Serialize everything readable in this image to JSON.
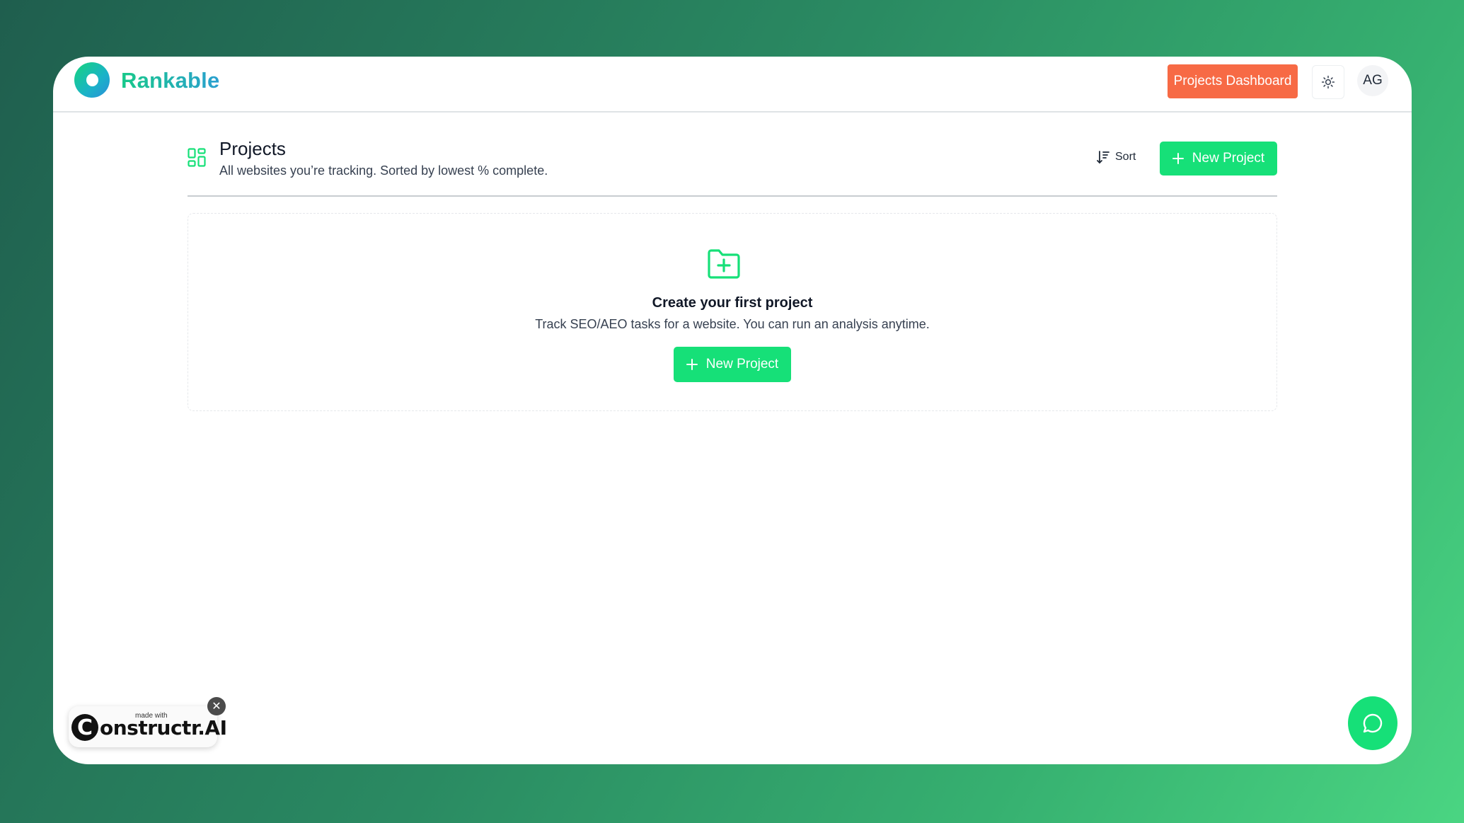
{
  "app": {
    "brand": "Rankable"
  },
  "header": {
    "dashboard_label": "Projects Dashboard",
    "avatar_initials": "AG",
    "theme_icon": "sun-icon"
  },
  "page": {
    "title": "Projects",
    "subtitle": "All websites you’re tracking. Sorted by lowest % complete.",
    "sort_label": "Sort",
    "new_project_label": "New Project"
  },
  "empty_state": {
    "icon": "folder-plus-icon",
    "title": "Create your first project",
    "subtitle": "Track SEO/AEO tasks for a website. You can run an analysis anytime.",
    "button_label": "New Project"
  },
  "badge": {
    "made_with": "made with",
    "c_letter": "C",
    "brand_rest": "onstructr.AI"
  },
  "colors": {
    "accent_green": "#16e078",
    "dashboard_orange": "#f76a45",
    "brand_gradient_start": "#18c98a",
    "brand_gradient_end": "#2a9fd0"
  }
}
